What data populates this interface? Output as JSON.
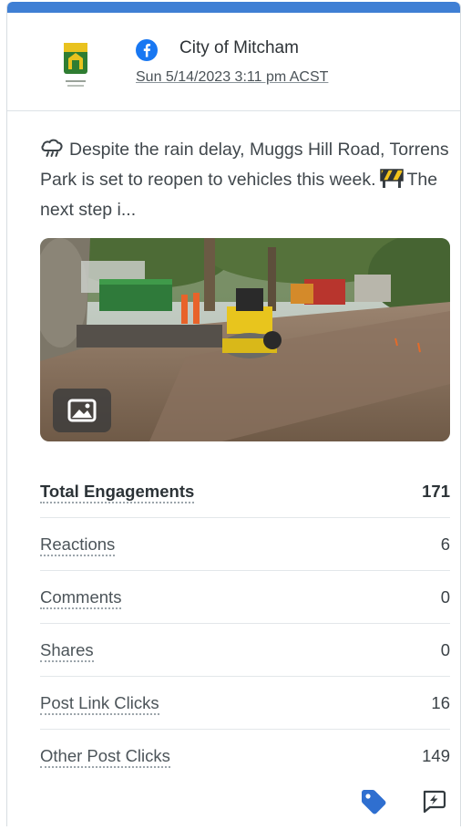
{
  "header": {
    "account_name": "City of Mitcham",
    "network_icon": "facebook-icon",
    "date": "Sun 5/14/2023 3:11 pm ACST",
    "logo": "city-of-mitcham-crest"
  },
  "post": {
    "text_before_emoji": "Despite the rain delay, Muggs Hill Road, Torrens Park is set to reopen to vehicles this week.",
    "text_after_emoji": "The next step i...",
    "lead_emoji": "cloud-rain-icon",
    "inline_emoji": "construction-barrier-icon",
    "media_type_icon": "image-icon"
  },
  "metrics": [
    {
      "label": "Total Engagements",
      "value": "171"
    },
    {
      "label": "Reactions",
      "value": "6"
    },
    {
      "label": "Comments",
      "value": "0"
    },
    {
      "label": "Shares",
      "value": "0"
    },
    {
      "label": "Post Link Clicks",
      "value": "16"
    },
    {
      "label": "Other Post Clicks",
      "value": "149"
    }
  ],
  "footer": {
    "tag_icon": "tag-icon",
    "boost_icon": "boost-icon"
  },
  "colors": {
    "accent": "#3f7fd4",
    "facebook": "#1877f2",
    "tag": "#2f6fd0"
  }
}
